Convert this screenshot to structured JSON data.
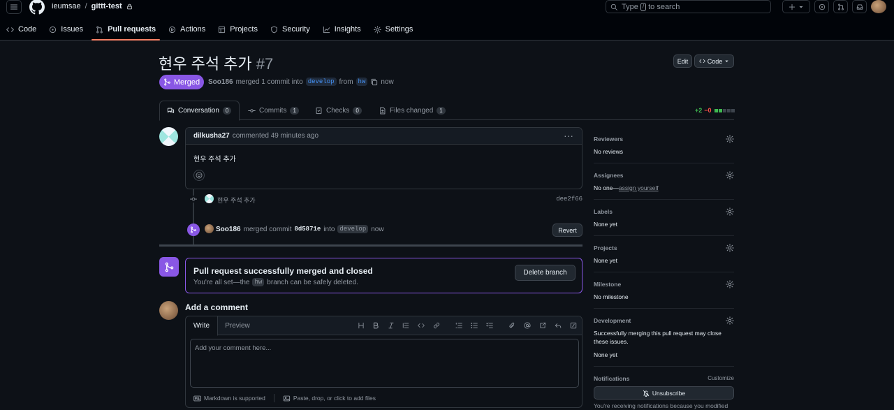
{
  "header": {
    "owner": "ieumsae",
    "separator": "/",
    "repo": "gittt-test",
    "search_prefix": "Type",
    "search_key": "/",
    "search_suffix": "to search",
    "nav_tabs": [
      {
        "label": "Code",
        "icon": "code-icon"
      },
      {
        "label": "Issues",
        "icon": "issue-icon"
      },
      {
        "label": "Pull requests",
        "icon": "pull-request-icon"
      },
      {
        "label": "Actions",
        "icon": "play-icon"
      },
      {
        "label": "Projects",
        "icon": "table-icon"
      },
      {
        "label": "Security",
        "icon": "shield-icon"
      },
      {
        "label": "Insights",
        "icon": "graph-icon"
      },
      {
        "label": "Settings",
        "icon": "gear-icon"
      }
    ],
    "active_tab": "Pull requests"
  },
  "pr": {
    "title": "현우 주석 추가",
    "number": "#7",
    "edit_label": "Edit",
    "code_label": "Code",
    "state_label": "Merged",
    "author": "Soo186",
    "merge_text": "merged 1 commit into",
    "base_branch": "develop",
    "from_text": "from",
    "head_branch": "hw",
    "time": "now"
  },
  "pr_tabs": [
    {
      "label": "Conversation",
      "count": "0"
    },
    {
      "label": "Commits",
      "count": "1"
    },
    {
      "label": "Checks",
      "count": "0"
    },
    {
      "label": "Files changed",
      "count": "1"
    }
  ],
  "diffstat": {
    "additions": "+2",
    "deletions": "−0"
  },
  "comment": {
    "author": "dilkusha27",
    "action": "commented 49 minutes ago",
    "body": "현우 주석 추가"
  },
  "commit": {
    "message": "현우 주석 추가",
    "sha": "dee2f66"
  },
  "merge_event": {
    "author": "Soo186",
    "text": "merged commit",
    "sha": "8d5871e",
    "into": "into",
    "branch": "develop",
    "time": "now",
    "revert_label": "Revert"
  },
  "merged_box": {
    "title": "Pull request successfully merged and closed",
    "line_prefix": "You're all set—the",
    "branch": "hw",
    "line_suffix": "branch can be safely deleted.",
    "delete_label": "Delete branch"
  },
  "composer": {
    "title": "Add a comment",
    "write_tab": "Write",
    "preview_tab": "Preview",
    "placeholder": "Add your comment here...",
    "markdown_note": "Markdown is supported",
    "attach_note": "Paste, drop, or click to add files"
  },
  "sidebar": {
    "reviewers": {
      "label": "Reviewers",
      "value": "No reviews"
    },
    "assignees": {
      "label": "Assignees",
      "value_prefix": "No one—",
      "link": "assign yourself"
    },
    "labels": {
      "label": "Labels",
      "value": "None yet"
    },
    "projects": {
      "label": "Projects",
      "value": "None yet"
    },
    "milestone": {
      "label": "Milestone",
      "value": "No milestone"
    },
    "development": {
      "label": "Development",
      "note": "Successfully merging this pull request may close these issues.",
      "value": "None yet"
    },
    "notifications": {
      "label": "Notifications",
      "customize": "Customize",
      "unsubscribe": "Unsubscribe",
      "note": "You're receiving notifications because you modified"
    }
  },
  "colors": {
    "accent_merged": "#8957e5",
    "tab_underline": "#f78166",
    "bg": "#0d1117"
  }
}
